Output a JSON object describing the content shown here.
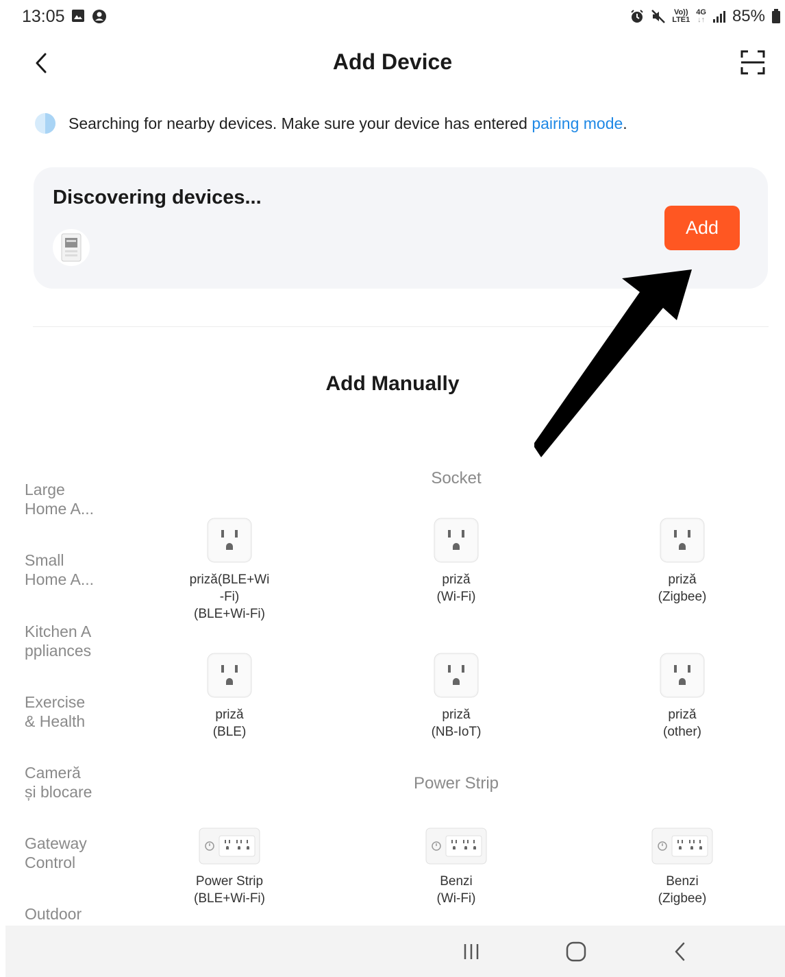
{
  "status_bar": {
    "time": "13:05",
    "signal_top": "Vo))",
    "signal_bottom": "LTE1",
    "network_top": "4G",
    "network_bottom": "↓↑",
    "battery": "85%"
  },
  "header": {
    "title": "Add Device"
  },
  "notice": {
    "text": "Searching for nearby devices. Make sure your device has entered ",
    "link": "pairing mode",
    "suffix": "."
  },
  "discover": {
    "title": "Discovering devices...",
    "add_label": "Add"
  },
  "manual": {
    "title": "Add Manually"
  },
  "categories": [
    {
      "label": "Large\nHome A..."
    },
    {
      "label": "Small\nHome A..."
    },
    {
      "label": "Kitchen A\nppliances"
    },
    {
      "label": "Exercise\n& Health"
    },
    {
      "label": "Cameră\nși blocare"
    },
    {
      "label": "Gateway\nControl"
    },
    {
      "label": "Outdoor"
    }
  ],
  "sections": {
    "socket": {
      "title": "Socket",
      "items": [
        {
          "label": "priză(BLE+Wi\n-Fi)\n(BLE+Wi-Fi)"
        },
        {
          "label": "priză\n(Wi-Fi)"
        },
        {
          "label": "priză\n(Zigbee)"
        },
        {
          "label": "priză\n(BLE)"
        },
        {
          "label": "priză\n(NB-IoT)"
        },
        {
          "label": "priză\n(other)"
        }
      ]
    },
    "power_strip": {
      "title": "Power Strip",
      "items": [
        {
          "label": "Power Strip\n(BLE+Wi-Fi)"
        },
        {
          "label": "Benzi\n(Wi-Fi)"
        },
        {
          "label": "Benzi\n(Zigbee)"
        }
      ]
    }
  },
  "colors": {
    "accent": "#ff5722",
    "link": "#1e88e5",
    "card_bg": "#f4f5f8"
  }
}
